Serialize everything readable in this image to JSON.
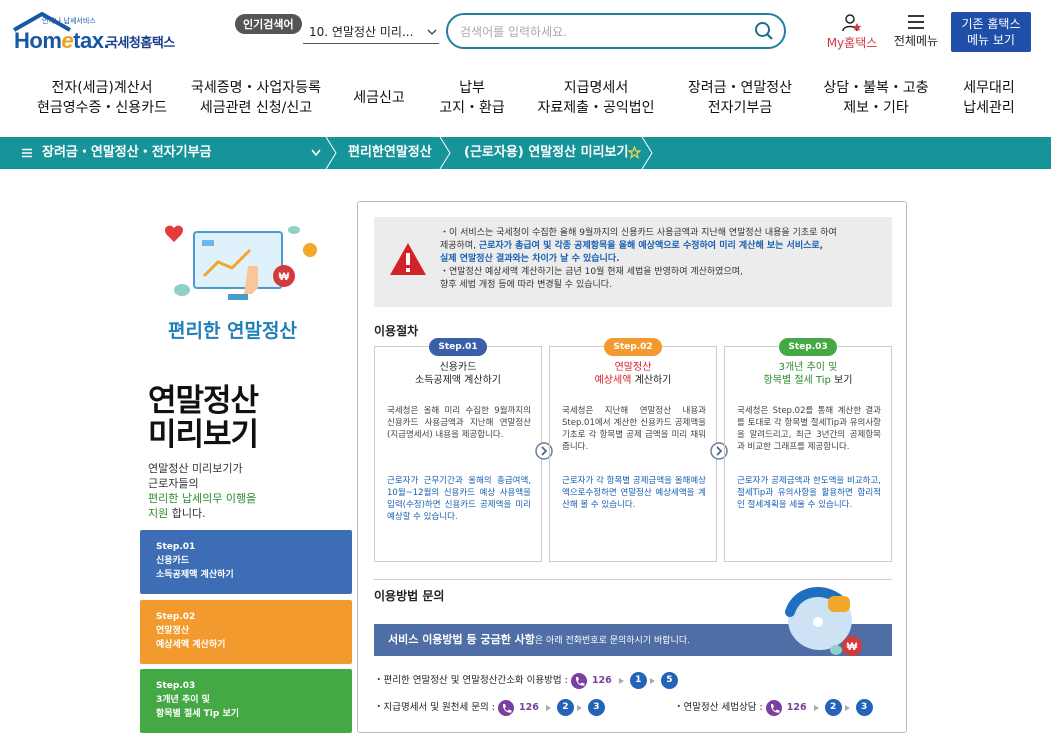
{
  "header": {
    "logo_sub": "언제나 납세서비스",
    "logo_brand": "Hometax.",
    "logo_name": "국세청홈택스",
    "popular_tag": "인기검색어",
    "popular_selected": "10. 연말정산 미리...",
    "search_placeholder": "검색어를 입력하세요.",
    "myhome_label": "My홈택스",
    "allmenu_label": "전체메뉴",
    "old_button_line1": "기존 홈택스",
    "old_button_line2": "메뉴 보기"
  },
  "gnb": [
    {
      "line1": "전자(세금)계산서",
      "line2": "현금영수증・신용카드"
    },
    {
      "line1": "국세증명・사업자등록",
      "line2": "세금관련 신청/신고"
    },
    {
      "line1": "세금신고",
      "line2": ""
    },
    {
      "line1": "납부",
      "line2": "고지・환급"
    },
    {
      "line1": "지급명세서",
      "line2": "자료제출・공익법인"
    },
    {
      "line1": "장려금・연말정산",
      "line2": "전자기부금"
    },
    {
      "line1": "상담・불복・고충",
      "line2": "제보・기타"
    },
    {
      "line1": "세무대리",
      "line2": "납세관리"
    }
  ],
  "location": {
    "menu": "장려금・연말정산・전자기부금",
    "level2": "편리한연말정산",
    "level3": "(근로자용) 연말정산 미리보기"
  },
  "left": {
    "subtitle": "편리한 연말정산",
    "title_line1": "연말정산",
    "title_line2": "미리보기",
    "desc_line1": "연말정산 미리보기가",
    "desc_line2": "근로자들의",
    "desc_green": "편리한 납세의무 이행을",
    "desc_green2": "지원",
    "desc_end": " 합니다.",
    "steps": [
      {
        "num": "Step.01",
        "line1": "신용카드",
        "line2": "소득공제액 계산하기",
        "color": "#3d6eb5"
      },
      {
        "num": "Step.02",
        "line1": "연말정산",
        "line2": "예상세액 계산하기",
        "color": "#f39a2e"
      },
      {
        "num": "Step.03",
        "line1": "3개년 추이 및",
        "line2": "항목별 절세 Tip 보기",
        "color": "#44a844"
      }
    ]
  },
  "notice": {
    "p1_a": "・이 서비스는 국세청이 수집한 올해 9월까지의 신용카드 사용금액과 지난해 연말정산 내용을 기초로 하여",
    "p1_b": "제공하며, ",
    "p1_blue": "근로자가 총급여 및 각종 공제항목을 올해 예상액으로 수정하여 미리 계산해 보는 서비스로,",
    "p1_blue2": "실제 연말정산 결과와는 차이가 날 수 있습니다.",
    "p2_a": "・연말정산 예상세액 계산하기는 금년 10월 현재 세법을 반영하여 계산하였으며,",
    "p2_b": "향후 세법 개정 등에 따라 변경될 수 있습니다."
  },
  "procedure": {
    "title": "이용절차",
    "steps": [
      {
        "badge": "Step.01",
        "badge_color": "#3a5fa8",
        "title1": "신용카드",
        "title2": "소득공제액 계산하기",
        "body": "국세청은 올해 미리 수집한 9월까지의 신용카드 사용금액과 지난해 연말정산(지급명세서) 내용을 제공합니다.",
        "highlight": "근로자가 근무기간과 올해의 총급여액, 10월~12월의 신용카드 예상 사용액을 입력(수정)하면 신용카드 공제액을 미리 예상할 수 있습니다."
      },
      {
        "badge": "Step.02",
        "badge_color": "#f39a2e",
        "title1": "연말정산",
        "title2": "예상세액 계산하기",
        "body": "국세청은 지난해 연말정산 내용과 Step.01에서 계산한 신용카드 공제액을 기초로 각 항목별 공제 금액을 미리 채워줍니다.",
        "highlight": "근로자가 각 항목별 공제금액을 올해예상액으로수정하면 연말정산 예상세액을 계산해 볼 수 있습니다."
      },
      {
        "badge": "Step.03",
        "badge_color": "#44a844",
        "title1": "3개년 추이 및",
        "title2": "항목별 절세 Tip 보기",
        "body": "국세청은 Step.02를 통해 계산한 결과를 토대로 각 항목별 절세Tip과 유의사항을 알려드리고, 최근 3년간의 공제항목과 비교한 그래프를 제공합니다.",
        "highlight": "근로자가 공제금액과 한도액을 비교하고, 절세Tip과 유의사항을 활용하면 합리적인 절세계획을 세울 수 있습니다."
      }
    ]
  },
  "inquiry": {
    "title": "이용방법 문의",
    "banner_bold": "서비스 이용방법 등 궁금한 사항",
    "banner_rest": "은 아래 전화번호로 문의하시기 바랍니다.",
    "row1_label": "・편리한 연말정산 및 연말정산간소화 이용방법 :",
    "row2_label": "・지급명세서 및 원천세 문의 :",
    "row3_label": "・연말정산 세법상담 :",
    "phone": "126",
    "row1_digits": [
      "1",
      "5"
    ],
    "row2_digits": [
      "2",
      "3"
    ],
    "row3_digits": [
      "2",
      "3"
    ]
  }
}
